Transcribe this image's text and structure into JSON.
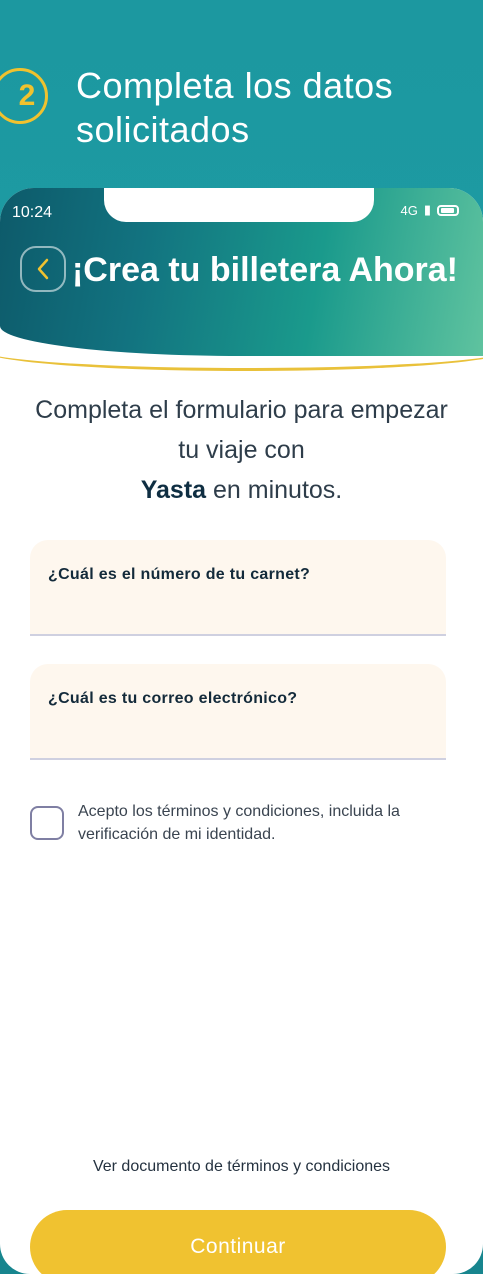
{
  "promo": {
    "step_number": "2",
    "step_title": "Completa los datos solicitados"
  },
  "status_bar": {
    "time": "10:24",
    "network": "4G"
  },
  "header": {
    "title": "¡Crea tu billetera Ahora!"
  },
  "intro": {
    "line_prefix": "Completa el formulario para empezar tu viaje con",
    "brand": "Yasta",
    "line_suffix": "en minutos."
  },
  "form": {
    "carnet_label": "¿Cuál es el número de tu carnet?",
    "carnet_value": "",
    "email_label": "¿Cuál es tu correo electrónico?",
    "email_value": ""
  },
  "terms": {
    "checked": false,
    "text": "Acepto los términos y condiciones, incluida la verificación de mi identidad."
  },
  "footer": {
    "terms_link": "Ver documento de términos y condiciones",
    "continue_label": "Continuar"
  },
  "colors": {
    "accent_yellow": "#f0c230",
    "teal": "#1f9aa2"
  }
}
